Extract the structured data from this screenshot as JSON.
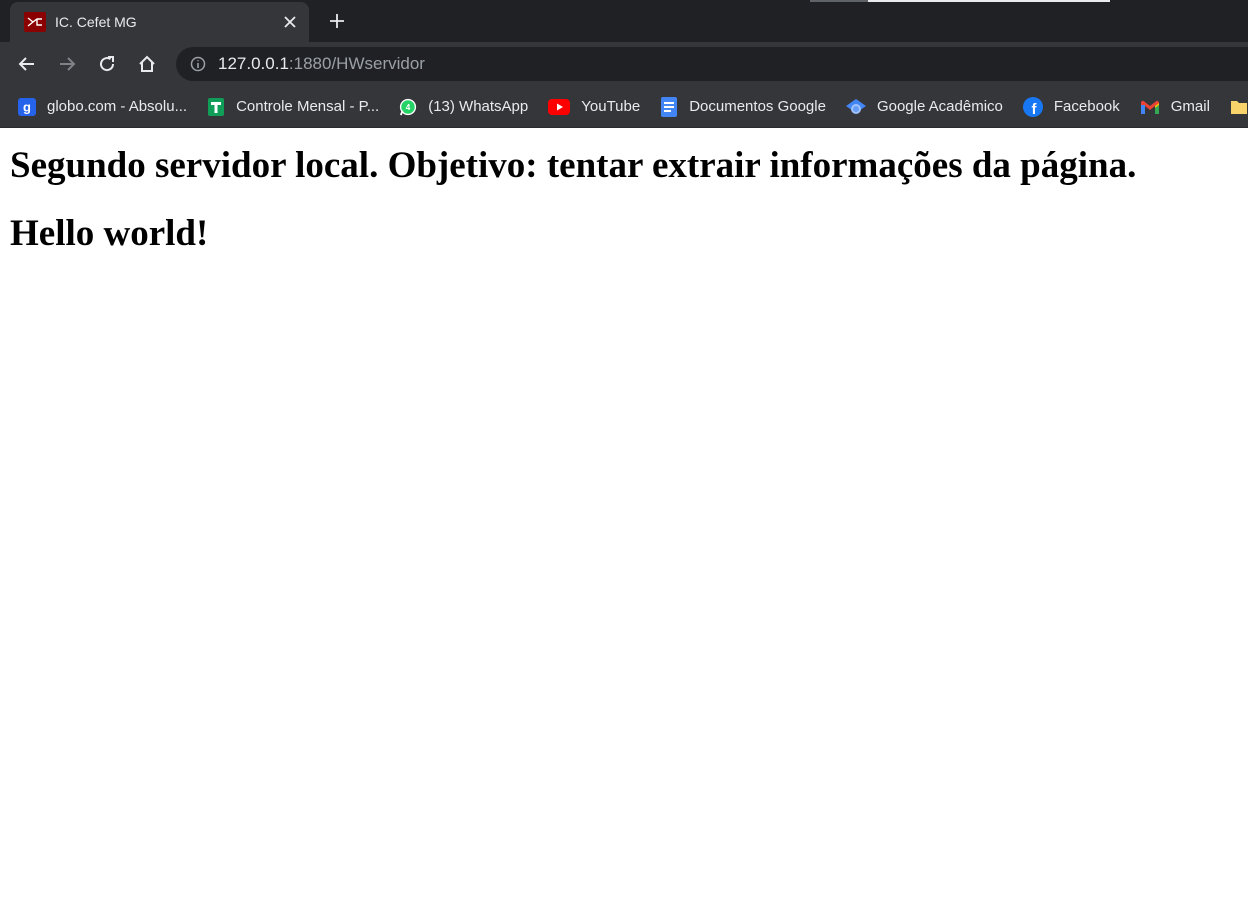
{
  "browser": {
    "tab": {
      "title": "IC. Cefet MG"
    },
    "address_bar": {
      "host": "127.0.0.1",
      "rest": ":1880/HWservidor"
    }
  },
  "bookmarks": [
    {
      "label": "globo.com - Absolu...",
      "icon": "globo-icon"
    },
    {
      "label": "Controle Mensal - P...",
      "icon": "sheets-icon"
    },
    {
      "label": "(13) WhatsApp",
      "icon": "whatsapp-icon"
    },
    {
      "label": "YouTube",
      "icon": "youtube-icon"
    },
    {
      "label": "Documentos Google",
      "icon": "docs-icon"
    },
    {
      "label": "Google Acadêmico",
      "icon": "scholar-icon"
    },
    {
      "label": "Facebook",
      "icon": "facebook-icon"
    },
    {
      "label": "Gmail",
      "icon": "gmail-icon"
    }
  ],
  "page": {
    "heading1": "Segundo servidor local. Objetivo: tentar extrair informações da página.",
    "heading2": "Hello world!"
  }
}
